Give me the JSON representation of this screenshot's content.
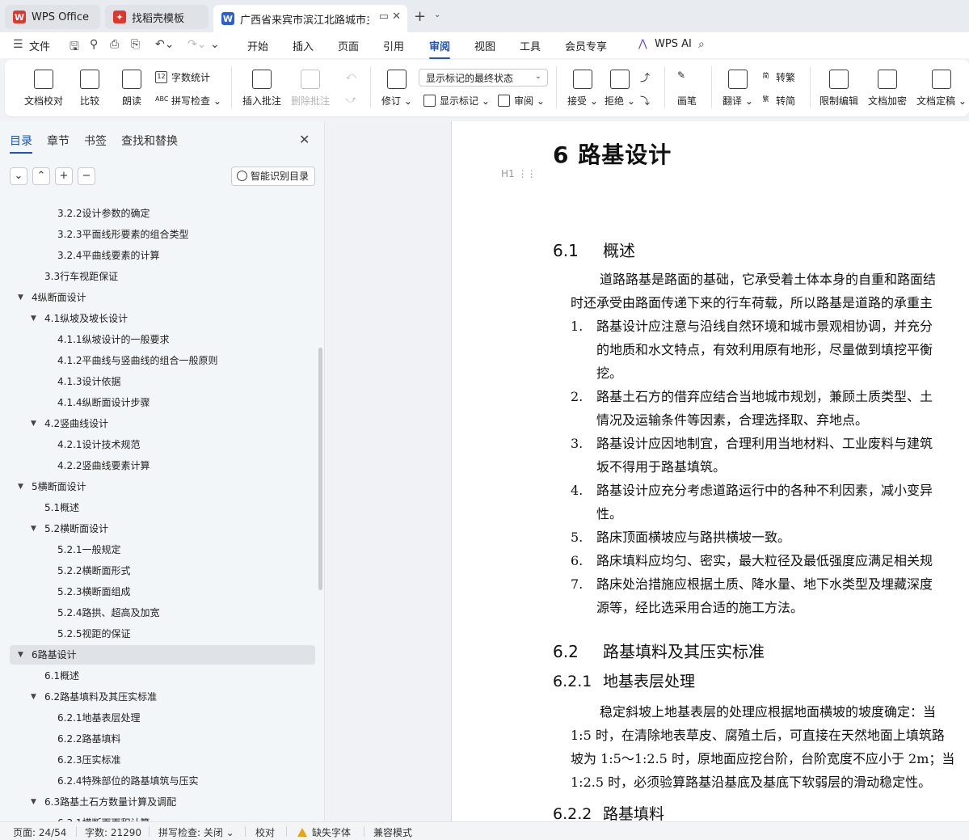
{
  "tabs": [
    {
      "label": "WPS Office",
      "icon": "wps-logo-icon",
      "color": "#e0362c"
    },
    {
      "label": "找稻壳模板",
      "icon": "docer-icon",
      "color": "#e0362c"
    },
    {
      "label": "广西省来宾市滨江北路城市主干",
      "icon": "word-doc-icon",
      "color": "#2b5fd9"
    }
  ],
  "menu": {
    "file": "文件",
    "items": [
      "开始",
      "插入",
      "页面",
      "引用",
      "审阅",
      "视图",
      "工具",
      "会员专享"
    ],
    "active": "审阅",
    "ai": "WPS AI"
  },
  "ribbon": {
    "doc_check": "文档校对",
    "compare": "比较",
    "read_aloud": "朗读",
    "word_count": "字数统计",
    "spell_check": "拼写检查",
    "insert_comment": "插入批注",
    "delete_comment": "删除批注",
    "revise": "修订",
    "markup_state": "显示标记的最终状态",
    "show_markup": "显示标记",
    "review": "审阅",
    "accept": "接受",
    "reject": "拒绝",
    "pen": "画笔",
    "translate": "翻译",
    "to_trad": "转繁",
    "to_simp": "转简",
    "restrict_edit": "限制编辑",
    "encrypt": "文档加密",
    "finalize": "文档定稿"
  },
  "nav": {
    "tabs": [
      "目录",
      "章节",
      "书签",
      "查找和替换"
    ],
    "smart_toc": "智能识别目录",
    "toc": [
      {
        "label": "3.2.2设计参数的确定",
        "level": 3,
        "arrow": ""
      },
      {
        "label": "3.2.3平面线形要素的组合类型",
        "level": 3,
        "arrow": ""
      },
      {
        "label": "3.2.4平曲线要素的计算",
        "level": 3,
        "arrow": ""
      },
      {
        "label": "3.3行车视距保证",
        "level": 2,
        "arrow": ""
      },
      {
        "label": "4纵断面设计",
        "level": 1,
        "arrow": "▼"
      },
      {
        "label": "4.1纵坡及坡长设计",
        "level": 2,
        "arrow": "▼"
      },
      {
        "label": "4.1.1纵坡设计的一般要求",
        "level": 3,
        "arrow": ""
      },
      {
        "label": "4.1.2平曲线与竖曲线的组合一般原则",
        "level": 3,
        "arrow": ""
      },
      {
        "label": "4.1.3设计依据",
        "level": 3,
        "arrow": ""
      },
      {
        "label": "4.1.4纵断面设计步骤",
        "level": 3,
        "arrow": ""
      },
      {
        "label": "4.2竖曲线设计",
        "level": 2,
        "arrow": "▼"
      },
      {
        "label": "4.2.1设计技术规范",
        "level": 3,
        "arrow": ""
      },
      {
        "label": "4.2.2竖曲线要素计算",
        "level": 3,
        "arrow": ""
      },
      {
        "label": "5横断面设计",
        "level": 1,
        "arrow": "▼"
      },
      {
        "label": "5.1概述",
        "level": 2,
        "arrow": ""
      },
      {
        "label": "5.2横断面设计",
        "level": 2,
        "arrow": "▼"
      },
      {
        "label": "5.2.1一般规定",
        "level": 3,
        "arrow": ""
      },
      {
        "label": "5.2.2横断面形式",
        "level": 3,
        "arrow": ""
      },
      {
        "label": "5.2.3横断面组成",
        "level": 3,
        "arrow": ""
      },
      {
        "label": "5.2.4路拱、超高及加宽",
        "level": 3,
        "arrow": ""
      },
      {
        "label": "5.2.5视距的保证",
        "level": 3,
        "arrow": ""
      },
      {
        "label": "6路基设计",
        "level": 1,
        "arrow": "▼",
        "selected": true
      },
      {
        "label": "6.1概述",
        "level": 2,
        "arrow": ""
      },
      {
        "label": "6.2路基填料及其压实标准",
        "level": 2,
        "arrow": "▼"
      },
      {
        "label": "6.2.1地基表层处理",
        "level": 3,
        "arrow": ""
      },
      {
        "label": "6.2.2路基填料",
        "level": 3,
        "arrow": ""
      },
      {
        "label": "6.2.3压实标准",
        "level": 3,
        "arrow": ""
      },
      {
        "label": "6.2.4特殊部位的路基填筑与压实",
        "level": 3,
        "arrow": ""
      },
      {
        "label": "6.3路基土石方数量计算及调配",
        "level": 2,
        "arrow": "▼"
      },
      {
        "label": "6.3.1横断面面积计算",
        "level": 3,
        "arrow": ""
      }
    ]
  },
  "doc": {
    "h1": "6 路基设计",
    "h1_marker": "H1",
    "s61_num": "6.1",
    "s61_title": "概述",
    "s61_p1": "道路路基是路面的基础，它承受着土体本身的自重和路面结",
    "s61_p2": "时还承受由路面传递下来的行车荷载，所以路基是道路的承重主",
    "list": [
      {
        "n": "1.",
        "lines": [
          "路基设计应注意与沿线自然环境和城市景观相协调，并充分",
          "的地质和水文特点，有效利用原有地形，尽量做到填挖平衡",
          "挖。"
        ]
      },
      {
        "n": "2.",
        "lines": [
          "路基土石方的借弃应结合当地城市规划，兼顾土质类型、土",
          "情况及运输条件等因素，合理选择取、弃地点。"
        ]
      },
      {
        "n": "3.",
        "lines": [
          "路基设计应因地制宜，合理利用当地材料、工业废料与建筑",
          "坂不得用于路基填筑。"
        ]
      },
      {
        "n": "4.",
        "lines": [
          "路基设计应充分考虑道路运行中的各种不利因素，减小变异",
          "性。"
        ]
      },
      {
        "n": "5.",
        "lines": [
          "路床顶面横坡应与路拱横坡一致。"
        ]
      },
      {
        "n": "6.",
        "lines": [
          "路床填料应均匀、密实，最大粒径及最低强度应满足相关规"
        ]
      },
      {
        "n": "7.",
        "lines": [
          "路床处治措施应根据土质、降水量、地下水类型及埋藏深度",
          "源等，经比选采用合适的施工方法。"
        ]
      }
    ],
    "s62_num": "6.2",
    "s62_title": "路基填料及其压实标准",
    "s621_num": "6.2.1",
    "s621_title": "地基表层处理",
    "s621_lines": [
      "稳定斜坡上地基表层的处理应根据地面横坡的坡度确定：当",
      "1:5 时，在清除地表草皮、腐殖土后，可直接在天然地面上填筑路",
      "坡为 1:5～1:2.5 时，原地面应挖台阶，台阶宽度不应小于 2m；当",
      "1:2.5 时，必须验算路基沿基底及基底下软弱层的滑动稳定性。"
    ],
    "s622_num": "6.2.2",
    "s622_title": "路基填料"
  },
  "status": {
    "page": "页面: 24/54",
    "words": "字数: 21290",
    "spell": "拼写检查: 关闭",
    "proof": "校对",
    "missing_font": "缺失字体",
    "compat": "兼容模式"
  }
}
